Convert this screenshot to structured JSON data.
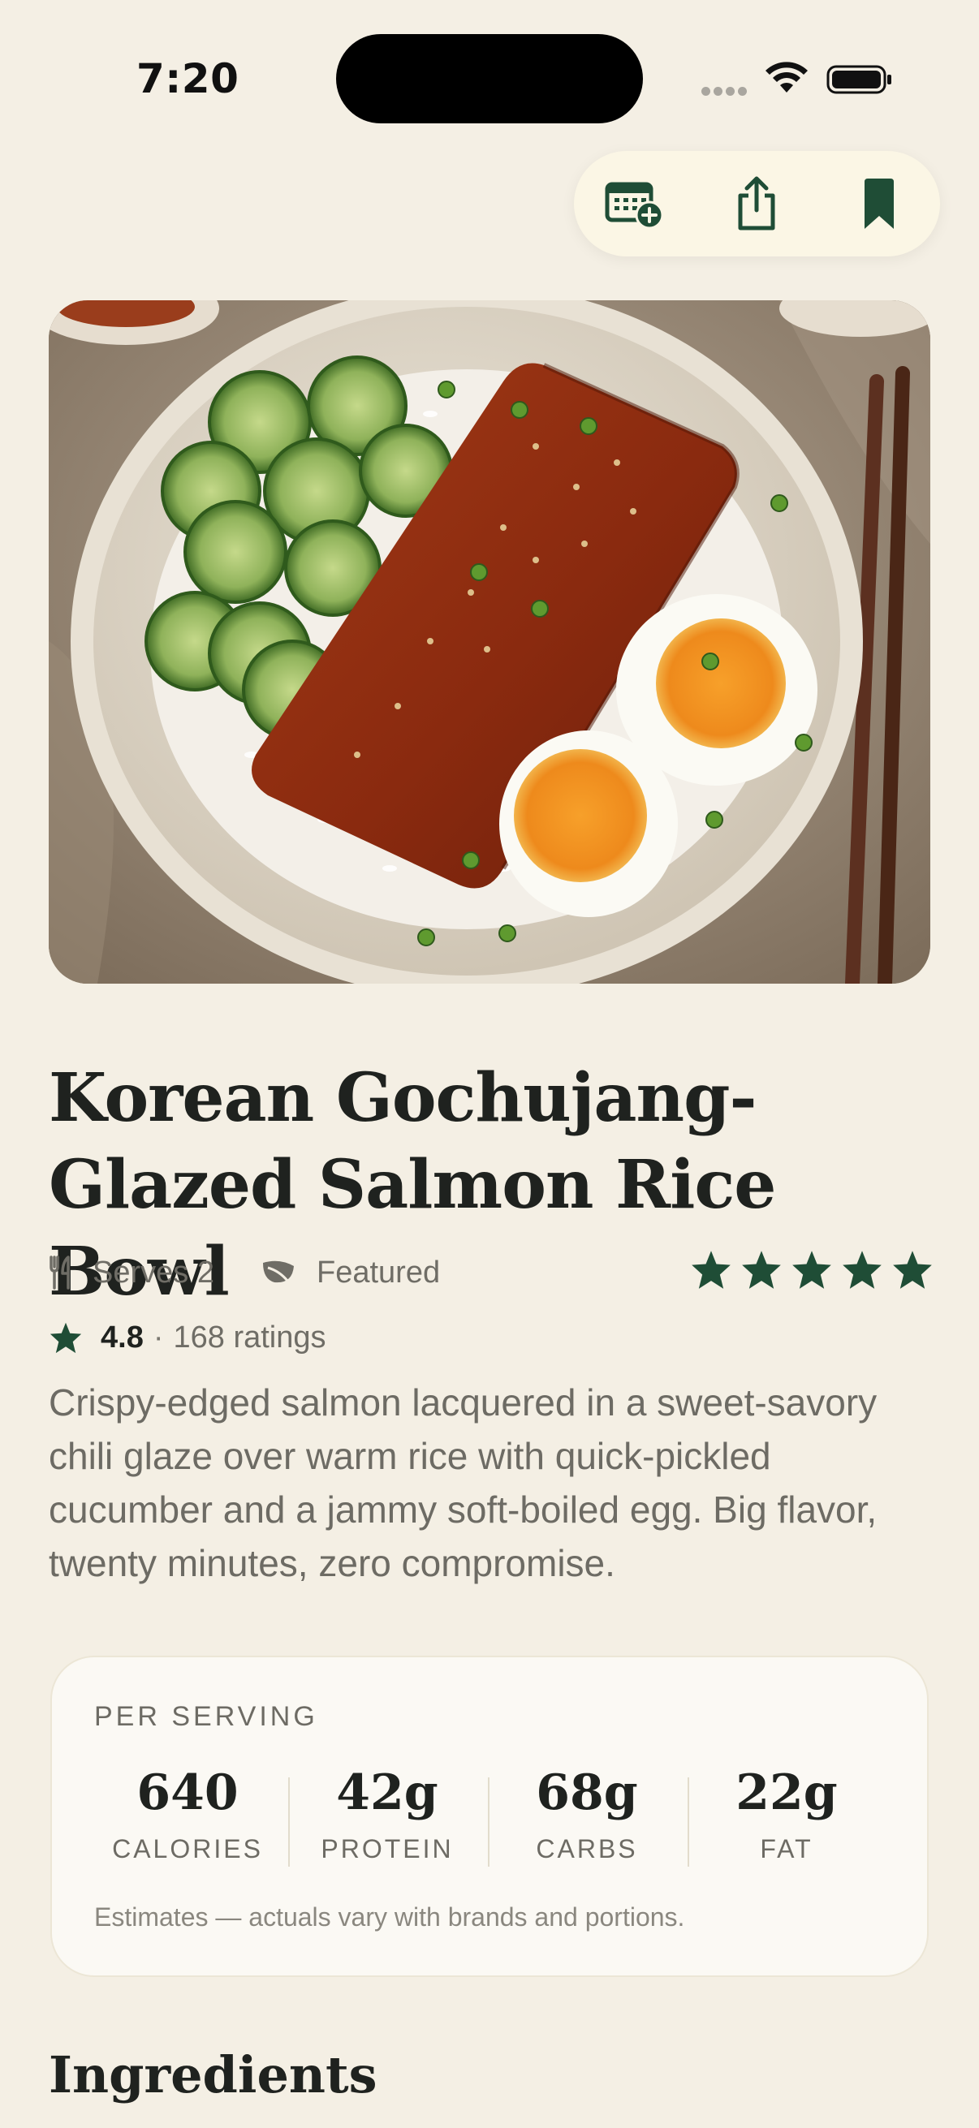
{
  "status_bar": {
    "time": "7:20"
  },
  "toolbar": {
    "buttons": [
      {
        "icon": "calendar-add-icon"
      },
      {
        "icon": "share-icon"
      },
      {
        "icon": "bookmark-icon"
      }
    ]
  },
  "colors": {
    "accent": "#1f4d36",
    "background": "#f4efe4",
    "card": "#fbf9f4"
  },
  "recipe": {
    "title_line1": "Korean Gochujang-",
    "title_line2": "Glazed Salmon Rice Bowl",
    "serves": "Serves 2",
    "featured": "Featured",
    "star_count": 5,
    "rating": "4.8",
    "rating_separator": "·",
    "ratings_count": "168 ratings",
    "description": "Crispy-edged salmon lacquered in a sweet-savory chili glaze over warm rice with quick-pickled cucumber and a jammy soft-boiled egg. Big flavor, twenty minutes, zero compromise."
  },
  "nutrition": {
    "heading": "PER SERVING",
    "stats": [
      {
        "value": "640",
        "label": "CALORIES"
      },
      {
        "value": "42g",
        "label": "PROTEIN"
      },
      {
        "value": "68g",
        "label": "CARBS"
      },
      {
        "value": "22g",
        "label": "FAT"
      }
    ],
    "note": "Estimates — actuals vary with brands and portions."
  },
  "sections": {
    "ingredients_title": "Ingredients"
  }
}
